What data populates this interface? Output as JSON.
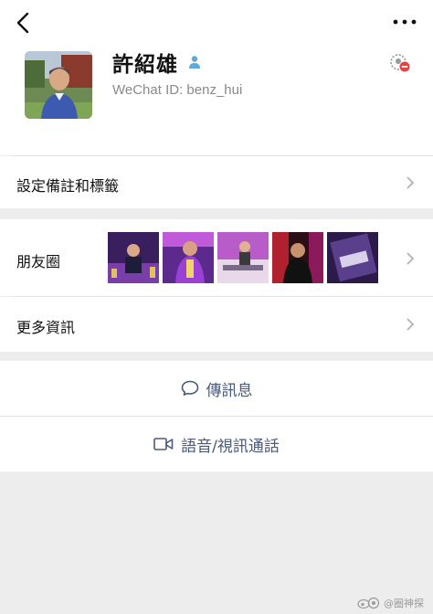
{
  "profile": {
    "name": "許紹雄",
    "wechat_id": "WeChat ID: benz_hui"
  },
  "rows": {
    "remarks_label": "設定備註和標籤",
    "moments_label": "朋友圈",
    "more_info_label": "更多資訊"
  },
  "actions": {
    "message_label": "傳訊息",
    "call_label": "語音/視訊通話"
  },
  "watermark": {
    "text": "@圈神探"
  },
  "colors": {
    "accent_link": "#4a5a78",
    "gender_male": "#5fa9d6",
    "block_red": "#e64340"
  },
  "icons": [
    "back-arrow-icon",
    "more-dots-icon",
    "male-gender-icon",
    "blocked-icon",
    "chevron-right-icon",
    "chat-bubble-icon",
    "video-camera-icon"
  ]
}
